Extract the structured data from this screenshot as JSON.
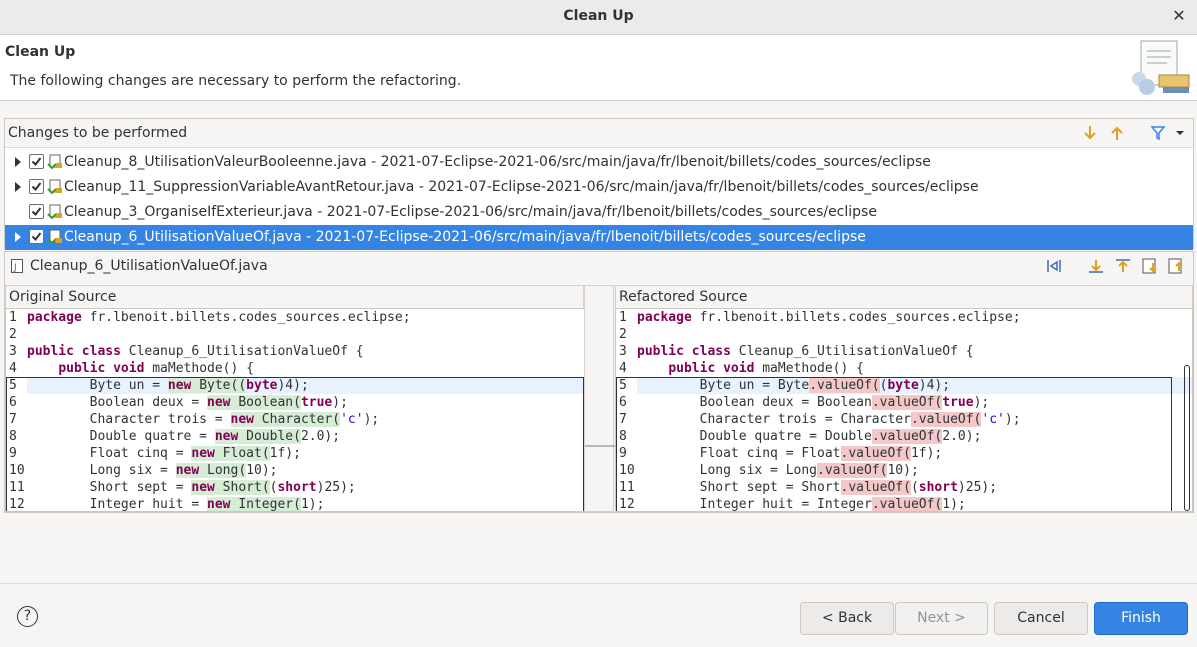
{
  "window": {
    "title": "Clean Up"
  },
  "header": {
    "title": "Clean Up",
    "description": "The following changes are necessary to perform the refactoring."
  },
  "changes": {
    "label": "Changes to be performed",
    "items": [
      {
        "text": "Cleanup_8_UtilisationValeurBooleenne.java - 2021-07-Eclipse-2021-06/src/main/java/fr/lbenoit/billets/codes_sources/eclipse",
        "checked": true,
        "expandable": true,
        "selected": false
      },
      {
        "text": "Cleanup_11_SuppressionVariableAvantRetour.java - 2021-07-Eclipse-2021-06/src/main/java/fr/lbenoit/billets/codes_sources/eclipse",
        "checked": true,
        "expandable": true,
        "selected": false
      },
      {
        "text": "Cleanup_3_OrganiseIfExterieur.java - 2021-07-Eclipse-2021-06/src/main/java/fr/lbenoit/billets/codes_sources/eclipse",
        "checked": true,
        "expandable": false,
        "selected": false
      },
      {
        "text": "Cleanup_6_UtilisationValueOf.java - 2021-07-Eclipse-2021-06/src/main/java/fr/lbenoit/billets/codes_sources/eclipse",
        "checked": true,
        "expandable": true,
        "selected": true
      }
    ]
  },
  "compare": {
    "filename": "Cleanup_6_UtilisationValueOf.java",
    "left_title": "Original Source",
    "right_title": "Refactored Source",
    "left_lines": [
      [
        {
          "t": "package",
          "k": "kw"
        },
        {
          "t": " fr.lbenoit.billets.codes_sources.eclipse;"
        }
      ],
      [],
      [
        {
          "t": "public class",
          "k": "kw"
        },
        {
          "t": " Cleanup_6_UtilisationValueOf {"
        }
      ],
      [
        {
          "t": "    "
        },
        {
          "t": "public void",
          "k": "kw"
        },
        {
          "t": " maMethode() {"
        }
      ],
      [
        {
          "t": "        Byte un = "
        },
        {
          "t": "new",
          "k": "kw",
          "h": "add"
        },
        {
          "t": " Byte(",
          "h": "add"
        },
        {
          "t": "(",
          "h": "add"
        },
        {
          "t": "byte",
          "k": "kw"
        },
        {
          "t": ")4);"
        }
      ],
      [
        {
          "t": "        Boolean deux = "
        },
        {
          "t": "new",
          "k": "kw",
          "h": "add"
        },
        {
          "t": " Boolean(",
          "h": "add"
        },
        {
          "t": "true",
          "k": "kw"
        },
        {
          "t": ");"
        }
      ],
      [
        {
          "t": "        Character trois = "
        },
        {
          "t": "new",
          "k": "kw",
          "h": "add"
        },
        {
          "t": " Character(",
          "h": "add"
        },
        {
          "t": "'c'",
          "k": "str"
        },
        {
          "t": ");"
        }
      ],
      [
        {
          "t": "        Double quatre = "
        },
        {
          "t": "new",
          "k": "kw",
          "h": "add"
        },
        {
          "t": " Double(",
          "h": "add"
        },
        {
          "t": "2.0);"
        }
      ],
      [
        {
          "t": "        Float cinq = "
        },
        {
          "t": "new",
          "k": "kw",
          "h": "add"
        },
        {
          "t": " Float(",
          "h": "add"
        },
        {
          "t": "1f);"
        }
      ],
      [
        {
          "t": "        Long six = "
        },
        {
          "t": "new",
          "k": "kw",
          "h": "add"
        },
        {
          "t": " Long(",
          "h": "add"
        },
        {
          "t": "10);"
        }
      ],
      [
        {
          "t": "        Short sept = "
        },
        {
          "t": "new",
          "k": "kw",
          "h": "add"
        },
        {
          "t": " Short(",
          "h": "add"
        },
        {
          "t": "("
        },
        {
          "t": "short",
          "k": "kw"
        },
        {
          "t": ")25);"
        }
      ],
      [
        {
          "t": "        Integer huit = "
        },
        {
          "t": "new",
          "k": "kw",
          "h": "add"
        },
        {
          "t": " Integer(",
          "h": "add"
        },
        {
          "t": "1);"
        }
      ]
    ],
    "right_lines": [
      [
        {
          "t": "package",
          "k": "kw"
        },
        {
          "t": " fr.lbenoit.billets.codes_sources.eclipse;"
        }
      ],
      [],
      [
        {
          "t": "public class",
          "k": "kw"
        },
        {
          "t": " Cleanup_6_UtilisationValueOf {"
        }
      ],
      [
        {
          "t": "    "
        },
        {
          "t": "public void",
          "k": "kw"
        },
        {
          "t": " maMethode() {"
        }
      ],
      [
        {
          "t": "        Byte un = Byte"
        },
        {
          "t": ".valueOf(",
          "h": "rem"
        },
        {
          "t": "("
        },
        {
          "t": "byte",
          "k": "kw"
        },
        {
          "t": ")4);"
        }
      ],
      [
        {
          "t": "        Boolean deux = Boolean"
        },
        {
          "t": ".valueOf(",
          "h": "rem"
        },
        {
          "t": "true",
          "k": "kw"
        },
        {
          "t": ");"
        }
      ],
      [
        {
          "t": "        Character trois = Character"
        },
        {
          "t": ".valueOf(",
          "h": "rem"
        },
        {
          "t": "'c'",
          "k": "str"
        },
        {
          "t": ");"
        }
      ],
      [
        {
          "t": "        Double quatre = Double"
        },
        {
          "t": ".valueOf(",
          "h": "rem"
        },
        {
          "t": "2.0);"
        }
      ],
      [
        {
          "t": "        Float cinq = Float"
        },
        {
          "t": ".valueOf(",
          "h": "rem"
        },
        {
          "t": "1f);"
        }
      ],
      [
        {
          "t": "        Long six = Long"
        },
        {
          "t": ".valueOf(",
          "h": "rem"
        },
        {
          "t": "10);"
        }
      ],
      [
        {
          "t": "        Short sept = Short"
        },
        {
          "t": ".valueOf(",
          "h": "rem"
        },
        {
          "t": "("
        },
        {
          "t": "short",
          "k": "kw"
        },
        {
          "t": ")25);"
        }
      ],
      [
        {
          "t": "        Integer huit = Integer"
        },
        {
          "t": ".valueOf(",
          "h": "rem"
        },
        {
          "t": "1);"
        }
      ]
    ]
  },
  "footer": {
    "back": "< Back",
    "next": "Next >",
    "cancel": "Cancel",
    "finish": "Finish",
    "help": "?"
  }
}
